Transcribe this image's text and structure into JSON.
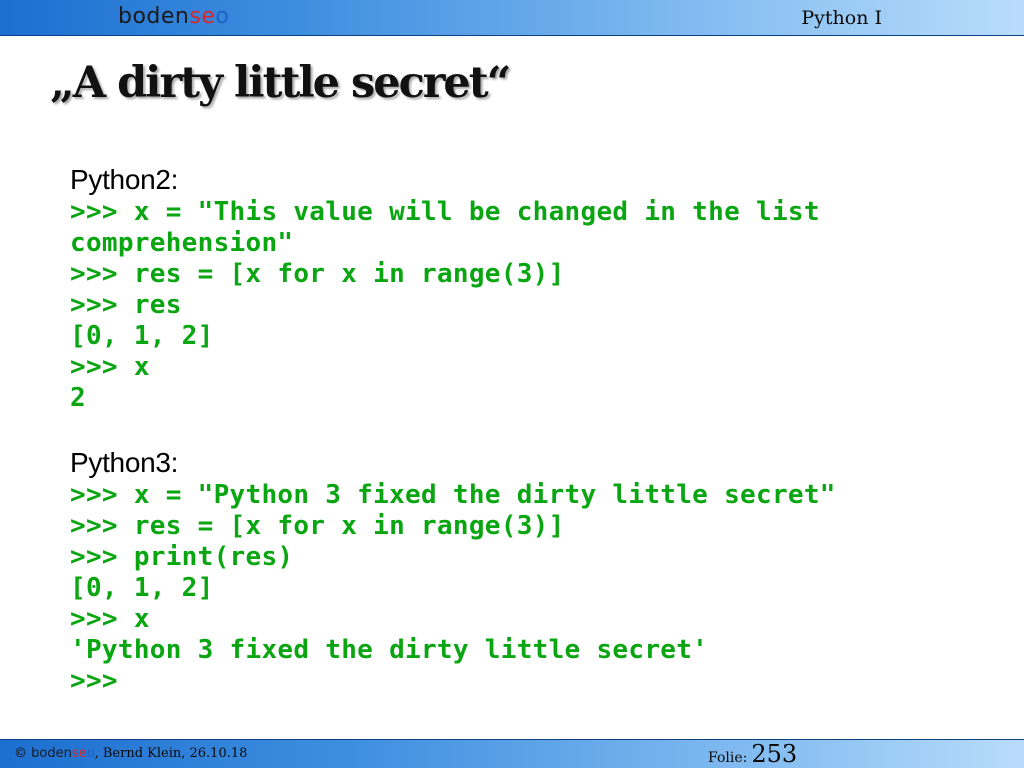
{
  "header": {
    "logo": {
      "part1": "boden",
      "part2": "se",
      "part3": "o"
    },
    "course": "Python I"
  },
  "slide": {
    "title": "„A dirty little secret“",
    "sections": [
      {
        "label": "Python2:",
        "lines": [
          ">>> x = \"This value will be changed in the list",
          "comprehension\"",
          ">>> res = [x for x in range(3)]",
          ">>> res",
          "[0, 1, 2]",
          ">>> x",
          "2"
        ]
      },
      {
        "label": "Python3:",
        "lines": [
          ">>> x = \"Python 3 fixed the dirty little secret\"",
          ">>> res = [x for x in range(3)]",
          ">>> print(res)",
          "[0, 1, 2]",
          ">>> x",
          "'Python 3 fixed the dirty little secret'",
          ">>>"
        ]
      }
    ]
  },
  "footer": {
    "copyright": "©",
    "logo": {
      "part1": "boden",
      "part2": "se",
      "part3": "o"
    },
    "author_date": ", Bernd Klein, 26.10.18",
    "folie_label": "Folie:",
    "folie_number": "253"
  },
  "colors": {
    "logo_dark": "#1a1a1a",
    "logo_red": "#d8262a",
    "logo_green": "#1fa34a",
    "logo_blue": "#1e62c8",
    "code": "#0aa612"
  }
}
